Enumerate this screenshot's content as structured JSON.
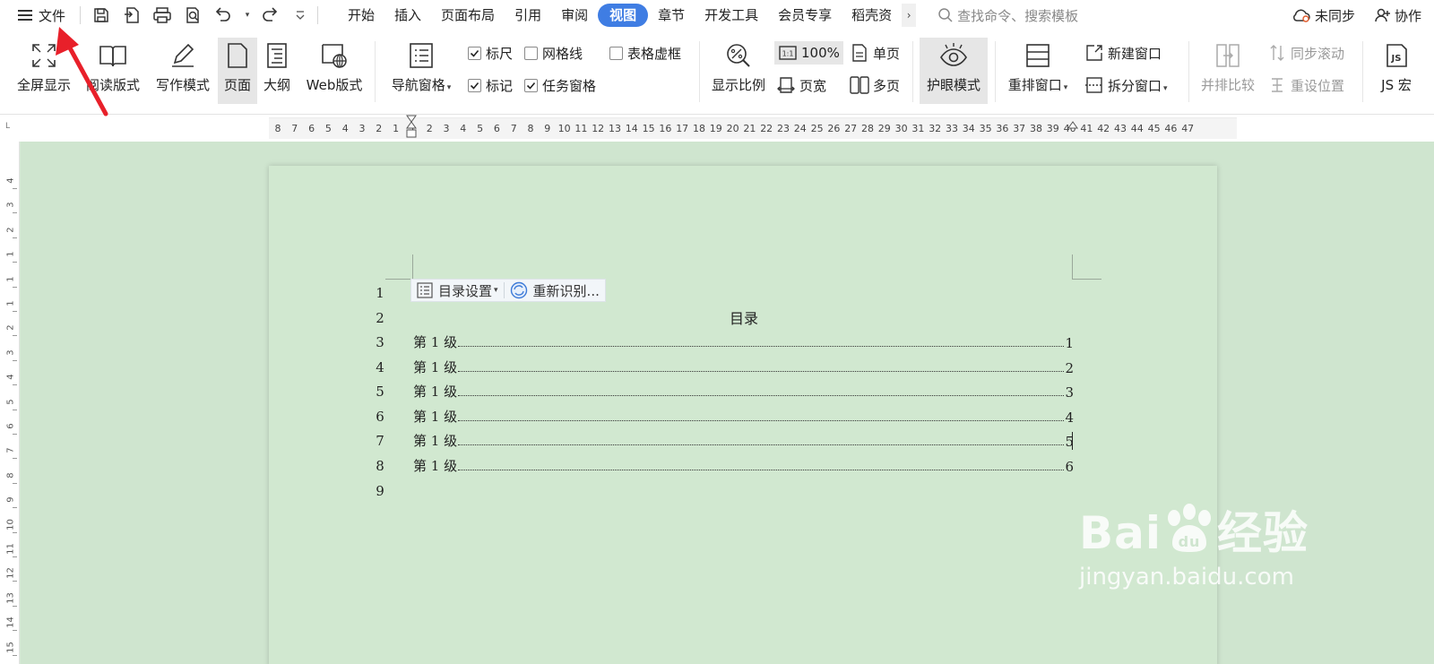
{
  "menubar": {
    "file_label": "文件",
    "tabs": [
      {
        "label": "开始"
      },
      {
        "label": "插入"
      },
      {
        "label": "页面布局"
      },
      {
        "label": "引用"
      },
      {
        "label": "审阅"
      },
      {
        "label": "视图"
      },
      {
        "label": "章节"
      },
      {
        "label": "开发工具"
      },
      {
        "label": "会员专享"
      },
      {
        "label": "稻壳资"
      }
    ],
    "active_tab": "视图",
    "more_glyph": "›",
    "search_placeholder": "查找命令、搜索模板",
    "sync_label": "未同步",
    "collab_label": "协作"
  },
  "ribbon": {
    "fullscreen": "全屏显示",
    "reading": "阅读版式",
    "writing": "写作模式",
    "page": "页面",
    "outline": "大纲",
    "web": "Web版式",
    "nav_pane": "导航窗格",
    "ruler": "标尺",
    "ruler_checked": true,
    "gridlines": "网格线",
    "gridlines_checked": false,
    "table_gridlines": "表格虚框",
    "table_gridlines_checked": false,
    "marks": "标记",
    "marks_checked": true,
    "task_pane": "任务窗格",
    "task_pane_checked": true,
    "zoom": "显示比例",
    "zoom_100": "100%",
    "page_width": "页宽",
    "single_page": "单页",
    "multi_page": "多页",
    "eye_mode": "护眼模式",
    "rearrange": "重排窗口",
    "new_window": "新建窗口",
    "split_window": "拆分窗口",
    "side_by_side": "并排比较",
    "sync_scroll": "同步滚动",
    "reset_position": "重设位置",
    "macro": "JS 宏"
  },
  "ruler": {
    "corner": "L",
    "h_numbers": [
      "8",
      "7",
      "6",
      "5",
      "4",
      "3",
      "2",
      "1",
      "1",
      "2",
      "3",
      "4",
      "5",
      "6",
      "7",
      "8",
      "9",
      "10",
      "11",
      "12",
      "13",
      "14",
      "15",
      "16",
      "17",
      "18",
      "19",
      "20",
      "21",
      "22",
      "23",
      "24",
      "25",
      "26",
      "27",
      "28",
      "29",
      "30",
      "31",
      "32",
      "33",
      "34",
      "35",
      "36",
      "37",
      "38",
      "39",
      "40",
      "41",
      "42",
      "43",
      "44",
      "45",
      "46",
      "47"
    ],
    "v_numbers": [
      "4",
      "3",
      "2",
      "1",
      "1",
      "1",
      "2",
      "3",
      "4",
      "5",
      "6",
      "7",
      "8",
      "9",
      "10",
      "11",
      "12",
      "13",
      "14",
      "15"
    ]
  },
  "document": {
    "toc_settings_label": "目录设置",
    "toc_refresh_label": "重新识别...",
    "toc_title": "目录",
    "line_numbers": [
      "1",
      "2",
      "3",
      "4",
      "5",
      "6",
      "7",
      "8",
      "9"
    ],
    "toc_entries": [
      {
        "label": "第 1 级",
        "page": "1"
      },
      {
        "label": "第 1 级",
        "page": "2"
      },
      {
        "label": "第 1 级",
        "page": "3"
      },
      {
        "label": "第 1 级",
        "page": "4"
      },
      {
        "label": "第 1 级",
        "page": "5"
      },
      {
        "label": "第 1 级",
        "page": "6"
      }
    ]
  },
  "watermark": {
    "brand": "Bai",
    "brand_cn": "经验",
    "url": "jingyan.baidu.com"
  },
  "colors": {
    "active_tab": "#3f7de3",
    "eye_mode_bg": "#d1e8d0",
    "annotation_arrow": "#e8202a"
  }
}
